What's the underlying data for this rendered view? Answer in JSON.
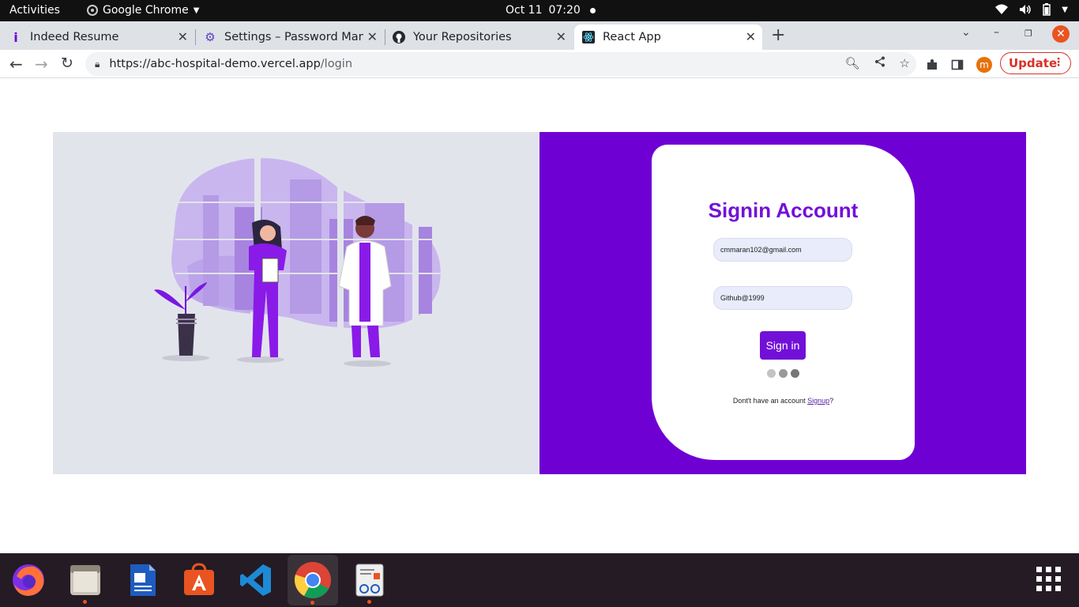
{
  "topbar": {
    "activities": "Activities",
    "app_name": "Google Chrome",
    "date": "Oct 11",
    "time": "07:20"
  },
  "tabs": [
    {
      "title": "Indeed Resume",
      "icon": "indeed-icon"
    },
    {
      "title": "Settings – Password Mana",
      "icon": "settings-gear-icon"
    },
    {
      "title": "Your Repositories",
      "icon": "github-icon"
    },
    {
      "title": "React App",
      "icon": "react-icon",
      "active": true
    }
  ],
  "toolbar": {
    "url_host": "https://abc-hospital-demo.vercel.app",
    "url_path": "/login",
    "profile_initial": "m",
    "update_label": "Update"
  },
  "login": {
    "title": "Signin Account",
    "email_value": "cmmaran102@gmail.com",
    "password_value": "Github@1999",
    "signin_label": "Sign in",
    "signup_prefix": "Dont't have an account ",
    "signup_link": "Signup",
    "signup_suffix": "?"
  },
  "colors": {
    "brand_purple": "#6f00d4",
    "panel_gray": "#e2e4ec",
    "ubuntu_orange": "#e95420"
  },
  "dock": [
    "firefox-icon",
    "files-icon",
    "writer-icon",
    "software-icon",
    "vscode-icon",
    "chrome-icon",
    "document-viewer-icon"
  ]
}
